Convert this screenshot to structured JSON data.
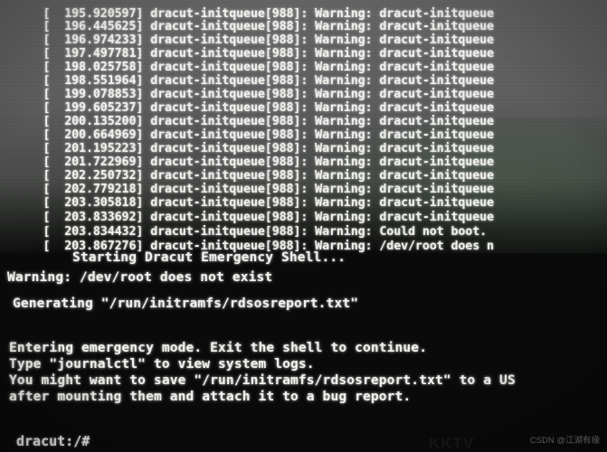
{
  "screen": {
    "type": "linux-console",
    "colors": {
      "background": "#0a0a0a",
      "text": "#f2f2ee",
      "glare_band": "#686868",
      "green_tint": "#486048",
      "watermark": "#c8c8c8"
    }
  },
  "log": {
    "service": "dracut-initqueue",
    "pid": "988",
    "level": "Warning",
    "lines": [
      {
        "timestamp": "195.920597]",
        "body": "dracut-initqueue[988]: Warning: dracut-initqueue",
        "partial": true
      },
      {
        "timestamp": "196.445625]",
        "body": "dracut-initqueue[988]: Warning: dracut-initqueue"
      },
      {
        "timestamp": "196.974233]",
        "body": "dracut-initqueue[988]: Warning: dracut-initqueue"
      },
      {
        "timestamp": "197.497781]",
        "body": "dracut-initqueue[988]: Warning: dracut-initqueue"
      },
      {
        "timestamp": "198.025758]",
        "body": "dracut-initqueue[988]: Warning: dracut-initqueue"
      },
      {
        "timestamp": "198.551964]",
        "body": "dracut-initqueue[988]: Warning: dracut-initqueue"
      },
      {
        "timestamp": "199.078853]",
        "body": "dracut-initqueue[988]: Warning: dracut-initqueue"
      },
      {
        "timestamp": "199.605237]",
        "body": "dracut-initqueue[988]: Warning: dracut-initqueue"
      },
      {
        "timestamp": "200.135200]",
        "body": "dracut-initqueue[988]: Warning: dracut-initqueue"
      },
      {
        "timestamp": "200.664969]",
        "body": "dracut-initqueue[988]: Warning: dracut-initqueue"
      },
      {
        "timestamp": "201.195223]",
        "body": "dracut-initqueue[988]: Warning: dracut-initqueue"
      },
      {
        "timestamp": "201.722969]",
        "body": "dracut-initqueue[988]: Warning: dracut-initqueue"
      },
      {
        "timestamp": "202.250732]",
        "body": "dracut-initqueue[988]: Warning: dracut-initqueue"
      },
      {
        "timestamp": "202.779218]",
        "body": "dracut-initqueue[988]: Warning: dracut-initqueue"
      },
      {
        "timestamp": "203.305818]",
        "body": "dracut-initqueue[988]: Warning: dracut-initqueue"
      },
      {
        "timestamp": "203.833692]",
        "body": "dracut-initqueue[988]: Warning: dracut-initqueue"
      },
      {
        "timestamp": "203.834432]",
        "body": "dracut-initqueue[988]: Warning: Could not boot."
      },
      {
        "timestamp": "203.867276]",
        "body": "dracut-initqueue[988]: Warning: /dev/root does n"
      }
    ]
  },
  "messages": {
    "starting_shell": "         Starting Dracut Emergency Shell...",
    "warning_root": "Warning: /dev/root does not exist",
    "generating": "Generating \"/run/initramfs/rdsosreport.txt\"",
    "entering": "Entering emergency mode. Exit the shell to continue.",
    "journalctl": "Type \"journalctl\" to view system logs.",
    "save_hint": "You might want to save \"/run/initramfs/rdsosreport.txt\" to a US",
    "mount_hint": "after mounting them and attach it to a bug report."
  },
  "prompt": {
    "text": "dracut:/#"
  },
  "watermarks": {
    "monitor_brand": "KKTV",
    "csdn": "CSDN @江湖有缘"
  }
}
